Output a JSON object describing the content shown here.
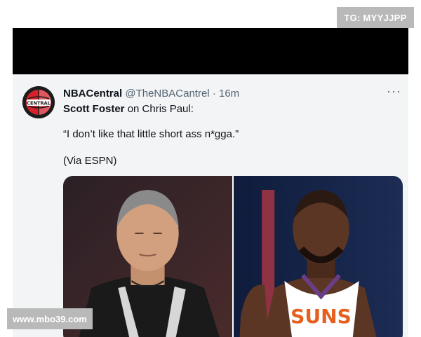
{
  "watermarks": {
    "top": "TG: MYYJJPP",
    "bottom": "www.mbo39.com"
  },
  "tweet": {
    "avatar_icon": "nba-central-logo-icon",
    "avatar_text": "CENTRAL",
    "display_name": "NBACentral",
    "handle": "@TheNBACantrel",
    "separator": "·",
    "time": "16m",
    "more_icon": "more-options-icon",
    "more_glyph": "···",
    "subject_name": "Scott Foster",
    "subject_rest": "on Chris Paul:",
    "quote": "“I don’t like that little short ass n*gga.”",
    "via": "(Via ESPN)"
  },
  "media": {
    "left_photo": "referee-photo",
    "right_photo": "player-photo",
    "jersey_text": "SUNS"
  },
  "colors": {
    "card_bg": "#f3f4f6",
    "text_primary": "#0f1419",
    "text_secondary": "#536471",
    "watermark_bg": "#b9b9b9",
    "jersey_orange": "#e56020"
  }
}
